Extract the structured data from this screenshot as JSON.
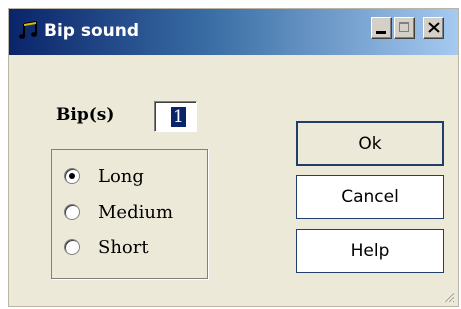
{
  "window": {
    "title": "Bip sound",
    "icon": "music-notes-icon"
  },
  "caption_buttons": [
    "minimize-icon",
    "maximize-icon",
    "close-icon"
  ],
  "form": {
    "bips_label": "Bip(s)",
    "bips_value": "1",
    "duration_options": [
      {
        "label": "Long",
        "selected": true
      },
      {
        "label": "Medium",
        "selected": false
      },
      {
        "label": "Short",
        "selected": false
      }
    ]
  },
  "buttons": {
    "ok": "Ok",
    "cancel": "Cancel",
    "help": "Help"
  },
  "colors": {
    "titlebar_start": "#0a246a",
    "titlebar_end": "#a6caf0",
    "dialog_bg": "#ece9d8"
  }
}
